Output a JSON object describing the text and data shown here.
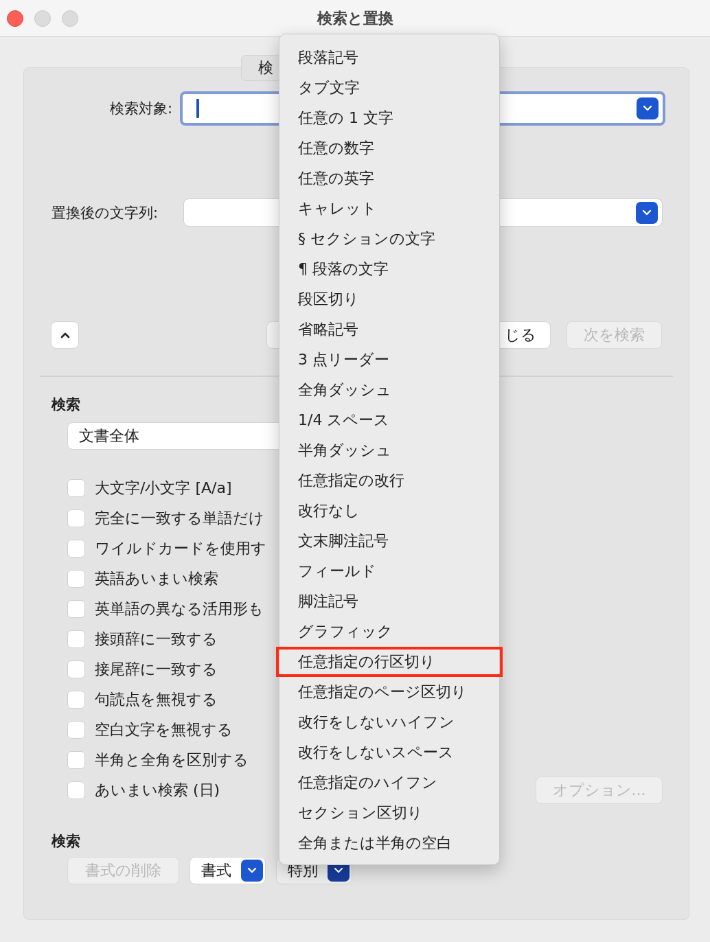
{
  "window": {
    "title": "検索と置換"
  },
  "tabs": [
    {
      "label": "検",
      "selected": true
    }
  ],
  "find_field": {
    "label": "検索対象:",
    "focused": true
  },
  "replace_field": {
    "label": "置換後の文字列:"
  },
  "buttons": {
    "close": "じる",
    "find_next": {
      "label": "次を検索",
      "disabled": true
    }
  },
  "search": {
    "heading": "検索",
    "scope": "文書全体"
  },
  "options": [
    {
      "label": "大文字/小文字 [A/a]",
      "checked": false
    },
    {
      "label": "完全に一致する単語だけ",
      "checked": false
    },
    {
      "label": "ワイルドカードを使用す",
      "checked": false
    },
    {
      "label": "英語あいまい検索",
      "checked": false
    },
    {
      "label": "英単語の異なる活用形も",
      "checked": false
    },
    {
      "label": "接頭辞に一致する",
      "checked": false
    },
    {
      "label": "接尾辞に一致する",
      "checked": false
    },
    {
      "label": "句読点を無視する",
      "checked": false
    },
    {
      "label": "空白文字を無視する",
      "checked": false
    },
    {
      "label": "半角と全角を区別する",
      "checked": false
    },
    {
      "label": "あいまい検索 (日)",
      "checked": false
    }
  ],
  "options_button": {
    "label": "オプション...",
    "disabled": true
  },
  "format": {
    "heading": "検索",
    "clear": {
      "label": "書式の削除",
      "disabled": true
    },
    "format_button": "書式",
    "special_button": "特別"
  },
  "special_menu": [
    {
      "label": "段落記号",
      "outlined": false
    },
    {
      "label": "タブ文字",
      "outlined": false
    },
    {
      "label": "任意の 1 文字",
      "outlined": false
    },
    {
      "label": "任意の数字",
      "outlined": false
    },
    {
      "label": "任意の英字",
      "outlined": false
    },
    {
      "label": "キャレット",
      "outlined": false
    },
    {
      "label": "§ セクションの文字",
      "outlined": false
    },
    {
      "label": "¶ 段落の文字",
      "outlined": false
    },
    {
      "label": "段区切り",
      "outlined": false
    },
    {
      "label": "省略記号",
      "outlined": false
    },
    {
      "label": "3 点リーダー",
      "outlined": false
    },
    {
      "label": "全角ダッシュ",
      "outlined": false
    },
    {
      "label": "1/4 スペース",
      "outlined": false
    },
    {
      "label": "半角ダッシュ",
      "outlined": false
    },
    {
      "label": "任意指定の改行",
      "outlined": false
    },
    {
      "label": "改行なし",
      "outlined": false
    },
    {
      "label": "文末脚注記号",
      "outlined": false
    },
    {
      "label": "フィールド",
      "outlined": false
    },
    {
      "label": "脚注記号",
      "outlined": false
    },
    {
      "label": "グラフィック",
      "outlined": false
    },
    {
      "label": "任意指定の行区切り",
      "outlined": true
    },
    {
      "label": "任意指定のページ区切り",
      "outlined": false
    },
    {
      "label": "改行をしないハイフン",
      "outlined": false
    },
    {
      "label": "改行をしないスペース",
      "outlined": false
    },
    {
      "label": "任意指定のハイフン",
      "outlined": false
    },
    {
      "label": "セクション区切り",
      "outlined": false
    },
    {
      "label": "全角または半角の空白",
      "outlined": false
    }
  ]
}
